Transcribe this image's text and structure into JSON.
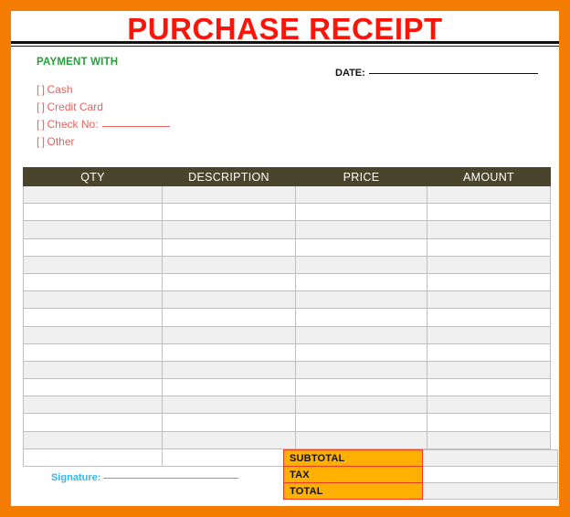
{
  "document": {
    "title": "PURCHASE RECEIPT",
    "accent_border_color": "#f47c00",
    "title_color": "#fc1409"
  },
  "payment": {
    "heading": "PAYMENT WITH",
    "heading_color": "#21a338",
    "option_color": "#e8635e",
    "options": [
      {
        "box": "[ ]",
        "label": "Cash",
        "has_line": false
      },
      {
        "box": "[ ]",
        "label": "Credit Card",
        "has_line": false
      },
      {
        "box": "[ ]",
        "label": "Check No:",
        "has_line": true
      },
      {
        "box": "[ ]",
        "label": "Other",
        "has_line": false
      }
    ]
  },
  "date": {
    "label": "DATE:",
    "value": ""
  },
  "table": {
    "header_bg": "#4a442c",
    "columns": [
      "QTY",
      "DESCRIPTION",
      "PRICE",
      "AMOUNT"
    ],
    "rows": [
      [
        "",
        "",
        "",
        ""
      ],
      [
        "",
        "",
        "",
        ""
      ],
      [
        "",
        "",
        "",
        ""
      ],
      [
        "",
        "",
        "",
        ""
      ],
      [
        "",
        "",
        "",
        ""
      ],
      [
        "",
        "",
        "",
        ""
      ],
      [
        "",
        "",
        "",
        ""
      ],
      [
        "",
        "",
        "",
        ""
      ],
      [
        "",
        "",
        "",
        ""
      ],
      [
        "",
        "",
        "",
        ""
      ],
      [
        "",
        "",
        "",
        ""
      ],
      [
        "",
        "",
        "",
        ""
      ],
      [
        "",
        "",
        "",
        ""
      ],
      [
        "",
        "",
        "",
        ""
      ],
      [
        "",
        "",
        "",
        ""
      ],
      [
        "",
        "",
        "",
        ""
      ]
    ]
  },
  "totals": {
    "label_bg": "#ffb000",
    "label_border": "#f03b20",
    "rows": [
      {
        "label": "SUBTOTAL",
        "value": ""
      },
      {
        "label": "TAX",
        "value": ""
      },
      {
        "label": "TOTAL",
        "value": ""
      }
    ]
  },
  "signature": {
    "label": "Signature:",
    "value": "",
    "color": "#30b9f0"
  }
}
